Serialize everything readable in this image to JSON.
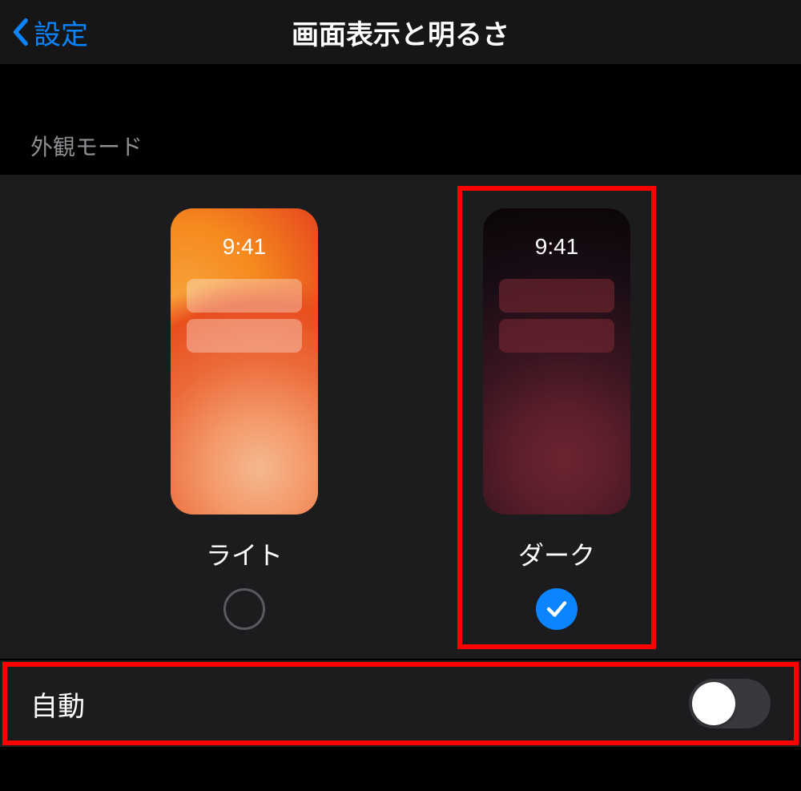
{
  "header": {
    "back_label": "設定",
    "title": "画面表示と明るさ"
  },
  "appearance": {
    "section_label": "外観モード",
    "preview_time": "9:41",
    "options": {
      "light": {
        "label": "ライト",
        "selected": false
      },
      "dark": {
        "label": "ダーク",
        "selected": true
      }
    }
  },
  "auto": {
    "label": "自動",
    "enabled": false
  },
  "highlights": {
    "dark_option": true,
    "auto_row": true
  },
  "colors": {
    "accent": "#0a84ff",
    "highlight": "#ff0000"
  }
}
